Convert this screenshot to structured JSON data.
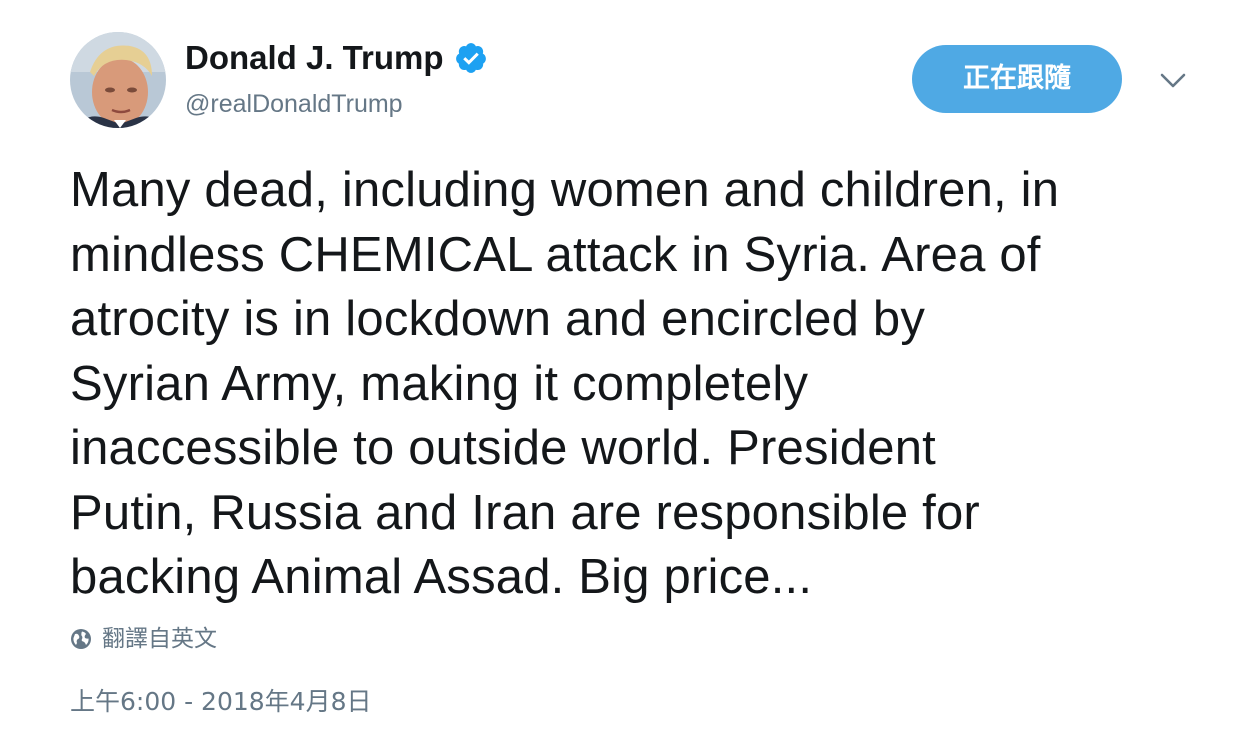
{
  "author": {
    "name": "Donald J. Trump",
    "handle": "@realDonaldTrump",
    "verified": true,
    "avatar_icon": "profile-photo"
  },
  "actions": {
    "follow_label": "正在跟隨",
    "more_icon": "chevron-down-icon"
  },
  "tweet": {
    "lines": [
      "Many dead, including women and children, in",
      "mindless CHEMICAL attack in Syria. Area of",
      "atrocity is in lockdown and encircled by",
      "Syrian Army, making it completely",
      "inaccessible to outside world. President",
      "Putin, Russia and Iran are responsible for",
      "backing Animal Assad. Big price..."
    ]
  },
  "translate": {
    "label": "翻譯自英文",
    "icon": "globe-icon"
  },
  "timestamp": "上午6:00 - 2018年4月8日",
  "colors": {
    "accent": "#4fa9e4",
    "verified": "#1da1f2",
    "text": "#14171a",
    "muted": "#657786",
    "background": "#ffffff"
  }
}
